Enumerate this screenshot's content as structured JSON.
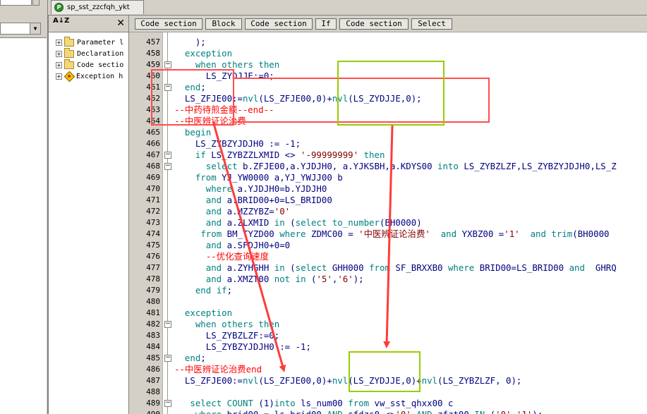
{
  "tab": {
    "label": "sp_sst_zzcfqh_ykt",
    "icon": "P"
  },
  "tree": {
    "sort_icon": "A↓Z",
    "close": "✕",
    "items": [
      {
        "label": "Parameter l",
        "icon": "folder-icon"
      },
      {
        "label": "Declaration",
        "icon": "folder-icon"
      },
      {
        "label": "Code sectio",
        "icon": "folder-icon"
      },
      {
        "label": "Exception h",
        "icon": "exception-icon"
      }
    ]
  },
  "breadcrumb": [
    "Code section",
    "Block",
    "Code section",
    "If",
    "Code section",
    "Select"
  ],
  "code_lines": [
    {
      "n": "457",
      "t": "    );"
    },
    {
      "n": "458",
      "t": "  exception"
    },
    {
      "n": "459",
      "t": "    when others then"
    },
    {
      "n": "460",
      "t": "      LS_ZYDJJE:=0;"
    },
    {
      "n": "461",
      "t": "  end;"
    },
    {
      "n": "462",
      "t": "  LS_ZFJE00:=nvl(LS_ZFJE00,0)+nvl(LS_ZYDJJE,0);"
    },
    {
      "n": "463",
      "t": "--中药待煎金额--end--"
    },
    {
      "n": "464",
      "t": "--中医辨证论治费"
    },
    {
      "n": "465",
      "t": "  begin"
    },
    {
      "n": "466",
      "t": "    LS_ZYBZYJDJH0 := -1;"
    },
    {
      "n": "467",
      "t": "    if LS_ZYBZZLXMID <> '-99999999' then"
    },
    {
      "n": "468",
      "t": "      select b.ZFJE00,a.YJDJH0, a.YJKSBH,a.KDYS00 into LS_ZYBZLZF,LS_ZYBZYJDJH0,LS_Z"
    },
    {
      "n": "469",
      "t": "    from YJ_YW0000 a,YJ_YWJJ00 b"
    },
    {
      "n": "470",
      "t": "      where a.YJDJH0=b.YJDJH0"
    },
    {
      "n": "471",
      "t": "      and a.BRID00+0=LS_BRID00"
    },
    {
      "n": "472",
      "t": "      and a.MZZYBZ='0'"
    },
    {
      "n": "473",
      "t": "      and a.ZLXMID in (select to_number(BH0000)"
    },
    {
      "n": "474",
      "t": "     from BM_TYZD00 where ZDMC00 = '中医辨证论治费'  and YXBZ00 ='1'  and trim(BH0000"
    },
    {
      "n": "475",
      "t": "      and a.SFDJH0+0=0"
    },
    {
      "n": "476",
      "t": "      --优化查询速度"
    },
    {
      "n": "477",
      "t": "      and a.ZYHGHH in (select GHH000 from SF_BRXXB0 where BRID00=LS_BRID00 and  GHRQ"
    },
    {
      "n": "478",
      "t": "      and a.XMZT00 not in ('5','6');"
    },
    {
      "n": "479",
      "t": "    end if;"
    },
    {
      "n": "480",
      "t": ""
    },
    {
      "n": "481",
      "t": "  exception"
    },
    {
      "n": "482",
      "t": "    when others then"
    },
    {
      "n": "483",
      "t": "      LS_ZYBZLZF:=0;"
    },
    {
      "n": "484",
      "t": "      LS_ZYBZYJDJH0 := -1;"
    },
    {
      "n": "485",
      "t": "  end;"
    },
    {
      "n": "486",
      "t": "--中医辨证论治费end"
    },
    {
      "n": "487",
      "t": "  LS_ZFJE00:=nvl(LS_ZFJE00,0)+nvl(LS_ZYDJJE,0)+nvl(LS_ZYBZLZF, 0);"
    },
    {
      "n": "488",
      "t": ""
    },
    {
      "n": "489",
      "t": "   select COUNT (1)into ls_num00 from vw_sst_qhxx00 c"
    },
    {
      "n": "490",
      "t": "    where brid00 = ls_brid00 AND sfdzs0 <>'0' AND zfzt00 IN ('0','1');"
    }
  ],
  "colors": {
    "keyword": "#008080",
    "comment": "#ff0000",
    "identifier": "#000080",
    "annotation_red": "#ff4d4d",
    "annotation_green": "#99cc00"
  }
}
